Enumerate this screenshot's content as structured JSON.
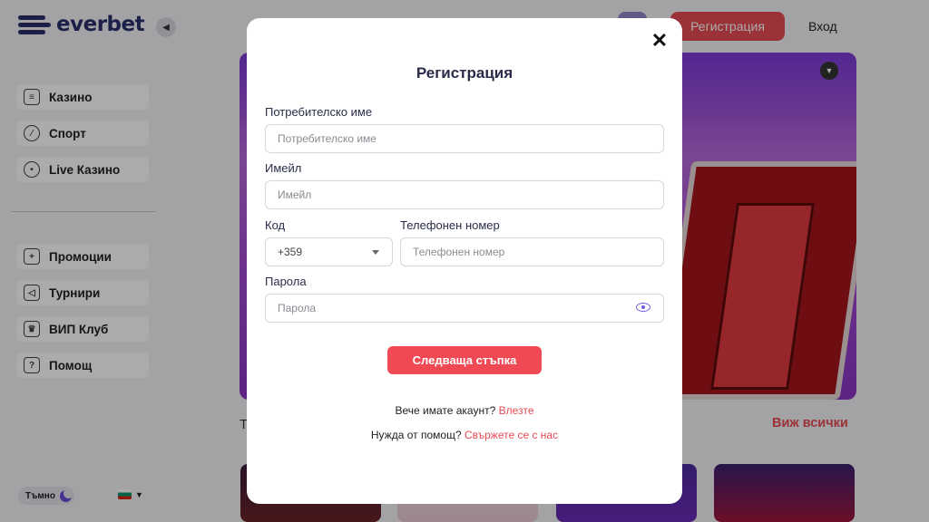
{
  "brand": {
    "name": "everbet"
  },
  "header": {
    "register_label": "Регистрация",
    "login_label": "Вход"
  },
  "sidebar": {
    "items_top": [
      {
        "label": "Казино",
        "icon": "slot-machine-icon"
      },
      {
        "label": "Спорт",
        "icon": "ball-icon"
      },
      {
        "label": "Live Казино",
        "icon": "dealer-icon"
      }
    ],
    "items_bottom": [
      {
        "label": "Промоции",
        "icon": "gift-icon"
      },
      {
        "label": "Турнири",
        "icon": "megaphone-icon"
      },
      {
        "label": "ВИП Клуб",
        "icon": "crown-icon"
      },
      {
        "label": "Помощ",
        "icon": "help-icon"
      }
    ],
    "theme_label": "Тъмно"
  },
  "content": {
    "section_title_partial": "Т",
    "see_all": "Виж всички"
  },
  "modal": {
    "title": "Регистрация",
    "username": {
      "label": "Потребителско име",
      "placeholder": "Потребителско име"
    },
    "email": {
      "label": "Имейл",
      "placeholder": "Имейл"
    },
    "code": {
      "label": "Код",
      "value": "+359"
    },
    "phone": {
      "label": "Телефонен номер",
      "placeholder": "Телефонен номер"
    },
    "password": {
      "label": "Парола",
      "placeholder": "Парола"
    },
    "next_label": "Следваща стъпка",
    "have_account_text": "Вече имате акаунт?",
    "login_link": "Влезте",
    "help_text": "Нужда от помощ?",
    "contact_link": "Свържете се с нас"
  },
  "colors": {
    "accent": "#e84b54",
    "brand": "#2b2f6b",
    "eye": "#6c5ce0"
  }
}
